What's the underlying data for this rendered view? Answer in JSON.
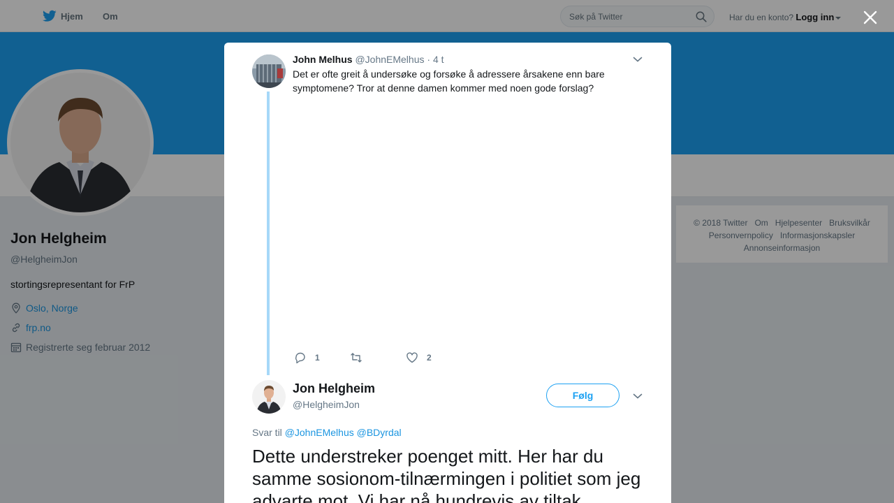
{
  "nav": {
    "home_label": "Hjem",
    "about_label": "Om",
    "search_placeholder": "Søk på Twitter",
    "account_prompt": "Har du en konto?",
    "login_label": "Logg inn"
  },
  "profile": {
    "name": "Jon Helgheim",
    "handle": "@HelgheimJon",
    "bio": "stortingsrepresentant for FrP",
    "location": "Oslo, Norge",
    "website": "frp.no",
    "joined": "Registrerte seg februar 2012"
  },
  "footer": {
    "links": [
      "© 2018 Twitter",
      "Om",
      "Hjelpesenter",
      "Bruksvilkår",
      "Personvernpolicy",
      "Informasjonskapsler",
      "Annonseinformasjon"
    ]
  },
  "tweet1": {
    "author_name": "John Melhus",
    "author_handle": "@JohnEMelhus",
    "time": "· 4 t",
    "text": "Det er ofte greit å undersøke og forsøke å adressere årsakene enn bare symptomene? Tror at denne damen kommer   med noen gode forslag?",
    "reply_count": "1",
    "retweet_count": "",
    "like_count": "2"
  },
  "tweet2": {
    "author_name": "Jon Helgheim",
    "author_handle": "@HelgheimJon",
    "follow_label": "Følg",
    "reply_prefix": "Svar til",
    "mention1": "@JohnEMelhus",
    "mention2": "@BDyrdal",
    "text": "Dette understreker poenget mitt. Her har du samme sosionom-tilnærmingen i politiet som jeg advarte mot. Vi har nå hundrevis av tiltak"
  },
  "colors": {
    "brand": "#1da1f2",
    "link": "#1b95e0",
    "thread_line": "#a6d8f8"
  }
}
